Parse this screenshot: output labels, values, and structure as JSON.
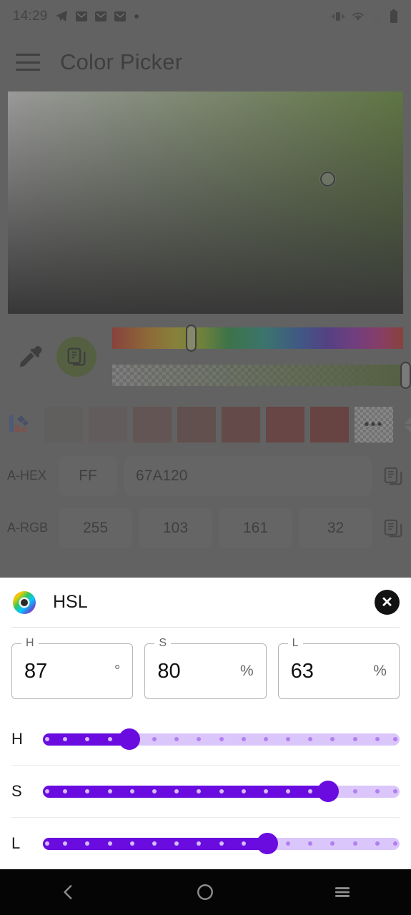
{
  "status_bar": {
    "time": "14:29",
    "left_icons": [
      "telegram-icon",
      "mail-icon",
      "mail-icon",
      "mail-icon",
      "dot-icon"
    ],
    "right_icons": [
      "vibrate-icon",
      "wifi-icon",
      "signal-icon",
      "battery-icon"
    ]
  },
  "toolbar": {
    "menu_icon": "hamburger-icon",
    "title": "Color Picker"
  },
  "picker": {
    "current_hex": "#67A120",
    "cursor_x_pct": 76,
    "cursor_y_pct": 37,
    "hue_thumb_pct": 25.2,
    "alpha_thumb_pct": 99,
    "eyedropper_label": "eyedropper-icon",
    "copy_label": "copy-icon"
  },
  "palette": {
    "icon": "palette-icon",
    "swatches": [
      "#6d6565",
      "#70605f",
      "#6f4d49",
      "#70403c",
      "#74322f",
      "#7b2723",
      "#7d1f1c"
    ],
    "more_label": "•••",
    "sort_icon": "sort-arrows-icon"
  },
  "values": {
    "rows": [
      {
        "label": "A-HEX",
        "fields": [
          {
            "value": "FF",
            "size": "small"
          },
          {
            "value": "67A120",
            "size": "grow"
          }
        ],
        "copy_icon": "copy-icon"
      },
      {
        "label": "A-RGB",
        "fields": [
          {
            "value": "255",
            "size": "quarter"
          },
          {
            "value": "103",
            "size": "quarter"
          },
          {
            "value": "161",
            "size": "quarter"
          },
          {
            "value": "32",
            "size": "quarter"
          }
        ],
        "copy_icon": "copy-icon"
      }
    ]
  },
  "sheet": {
    "wheel_icon": "color-wheel-icon",
    "title": "HSL",
    "close_icon": "close-icon",
    "inputs": [
      {
        "label": "H",
        "value": "87",
        "unit": "°"
      },
      {
        "label": "S",
        "value": "80",
        "unit": "%"
      },
      {
        "label": "L",
        "value": "63",
        "unit": "%"
      }
    ],
    "sliders": [
      {
        "label": "H",
        "value": 87,
        "max": 360,
        "percent": 24.2,
        "ticks": 17
      },
      {
        "label": "S",
        "value": 80,
        "max": 100,
        "percent": 80.0,
        "ticks": 17
      },
      {
        "label": "L",
        "value": 63,
        "max": 100,
        "percent": 63.0,
        "ticks": 17
      }
    ],
    "accent_color": "#6A0CE0",
    "track_color": "#DBC6FB"
  },
  "navbar": {
    "back_label": "back-icon",
    "home_label": "home-icon",
    "recents_label": "recents-icon"
  }
}
